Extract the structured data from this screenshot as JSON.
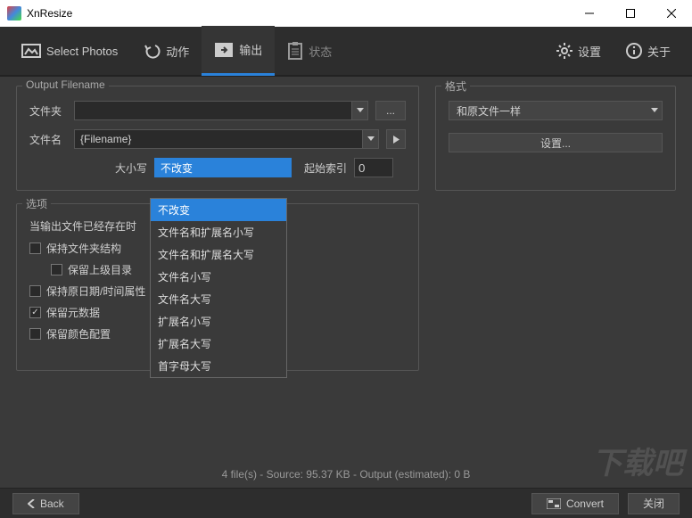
{
  "window": {
    "title": "XnResize"
  },
  "toolbar": {
    "select_photos": "Select Photos",
    "action": "动作",
    "output": "输出",
    "status": "状态",
    "settings": "设置",
    "about": "关于"
  },
  "output_panel": {
    "legend": "Output Filename",
    "folder_label": "文件夹",
    "folder_value": "",
    "browse": "...",
    "filename_label": "文件名",
    "filename_value": "{Filename}",
    "case_label": "大小写",
    "case_selected": "不改变",
    "case_options": [
      "不改变",
      "文件名和扩展名小写",
      "文件名和扩展名大写",
      "文件名小写",
      "文件名大写",
      "扩展名小写",
      "扩展名大写",
      "首字母大写"
    ],
    "start_index_label": "起始索引",
    "start_index_value": "0"
  },
  "options_panel": {
    "legend": "选项",
    "when_exists": "当输出文件已经存在时",
    "keep_folder": "保持文件夹结构",
    "keep_parent": "保留上级目录",
    "keep_date": "保持原日期/时间属性",
    "keep_meta": "保留元数据",
    "keep_color": "保留颜色配置"
  },
  "format_panel": {
    "legend": "格式",
    "same_as_original": "和原文件一样",
    "settings_btn": "设置..."
  },
  "status_line": "4 file(s) - Source: 95.37 KB - Output (estimated): 0 B",
  "footer": {
    "back": "Back",
    "convert": "Convert",
    "close": "关闭"
  },
  "watermark": "下载吧"
}
